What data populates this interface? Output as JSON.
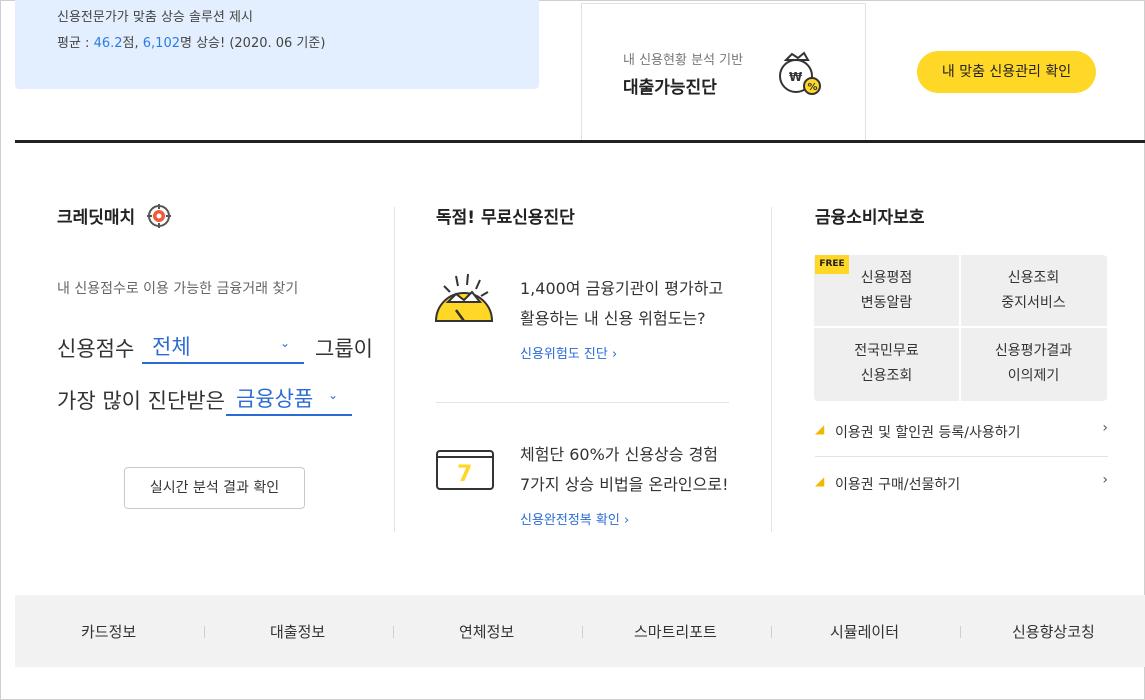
{
  "promo": {
    "line1": "신용전문가가 맞춤 상승 솔루션 제시",
    "line2_prefix": "평균 : ",
    "avg_score": "46.2",
    "unit_score": "점, ",
    "avg_people": "6,102",
    "line2_suffix": "명 상승!  (2020. 06 기준)"
  },
  "loan_box": {
    "subtitle": "내 신용현황 분석 기반",
    "title": "대출가능진단",
    "icon": "money-bag-percent-icon"
  },
  "cta_button": "내 맞춤 신용관리 확인",
  "credit_match": {
    "title": "크레딧매치",
    "description": "내 신용점수로 이용 가능한 금융거래 찾기",
    "row1_label": "신용점수",
    "score_select": "전체",
    "row1_suffix": "그룹이",
    "row2_label": "가장 많이 진단받은",
    "product_select": "금융상품",
    "button": "실시간 분석 결과 확인"
  },
  "free_diagnosis": {
    "title": "독점! 무료신용진단",
    "item1_line1": "1,400여 금융기관이 평가하고",
    "item1_line2": "활용하는 내 신용 위험도는?",
    "item1_link": "신용위험도 진단  ›",
    "item2_line1": "체험단 60%가 신용상승 경험",
    "item2_line2": "7가지 상승 비법을 온라인으로!",
    "item2_link": "신용완전정복 확인  ›",
    "item2_badge": "7"
  },
  "consumer_protection": {
    "title": "금융소비자보호",
    "free_badge": "FREE",
    "cells": [
      {
        "l1": "신용평점",
        "l2": "변동알람"
      },
      {
        "l1": "신용조회",
        "l2": "중지서비스"
      },
      {
        "l1": "전국민무료",
        "l2": "신용조회"
      },
      {
        "l1": "신용평가결과",
        "l2": "이의제기"
      }
    ],
    "links": [
      {
        "label": "이용권 및 할인권 등록/사용하기",
        "arrow": "›"
      },
      {
        "label": "이용권 구매/선물하기",
        "arrow": "›"
      }
    ]
  },
  "bottom_nav": [
    "카드정보",
    "대출정보",
    "연체정보",
    "스마트리포트",
    "시뮬레이터",
    "신용향상코칭"
  ],
  "colors": {
    "accent_blue": "#2b6bd6",
    "yellow": "#ffd726",
    "promo_bg": "#e3efff"
  }
}
